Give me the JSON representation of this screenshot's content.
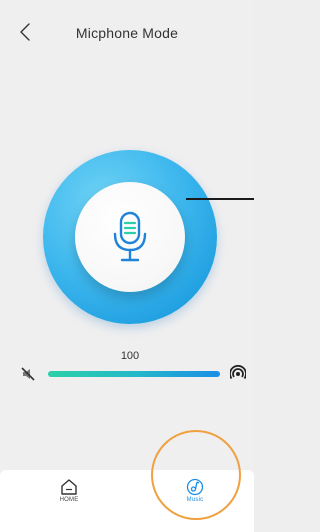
{
  "header": {
    "title": "Micphone Mode",
    "back_icon": "chevron-left-icon"
  },
  "dial": {
    "icon": "microphone-icon",
    "accent_color": "#2aa7e8"
  },
  "volume": {
    "value": "100",
    "level_percent": 100,
    "min_icon": "mute-icon",
    "max_icon": "loud-icon"
  },
  "bottom_nav": {
    "tabs": [
      {
        "label": "HOME",
        "icon": "home-icon",
        "active": false
      },
      {
        "label": "Music",
        "icon": "music-note-icon",
        "active": true
      }
    ]
  },
  "colors": {
    "accent": "#1c8ee6",
    "slider_start": "#2bd0a8",
    "highlight": "#f0a040"
  }
}
